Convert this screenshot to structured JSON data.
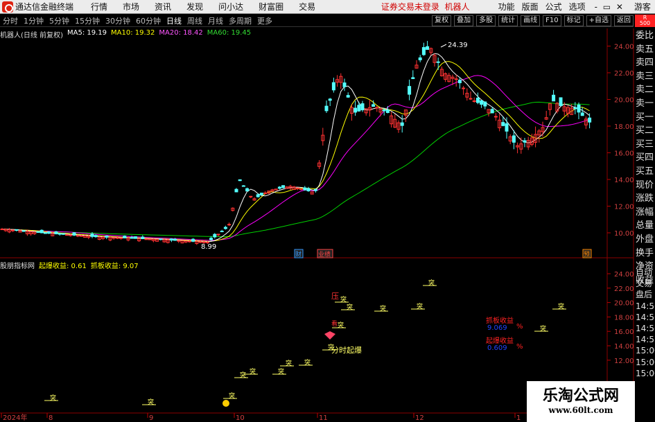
{
  "menubar": {
    "app_title": "通达信金融终端",
    "menu": [
      "行情",
      "市场",
      "资讯",
      "发现",
      "问小达",
      "财富圈",
      "交易"
    ],
    "warning": "证券交易未登录",
    "stock_name": "机器人",
    "right_menu": [
      "功能",
      "版面",
      "公式",
      "选项"
    ],
    "window_controls": "- ▭ ✕",
    "guest": "游客"
  },
  "periodbar": {
    "periods": [
      "分时",
      "1分钟",
      "5分钟",
      "15分钟",
      "30分钟",
      "60分钟",
      "日线",
      "周线",
      "月线",
      "多周期",
      "更多"
    ],
    "active": "日线",
    "tools": [
      "复权",
      "叠加",
      "多股",
      "统计",
      "画线",
      "F10",
      "标记",
      "+自选",
      "返回"
    ],
    "badge_r": "R",
    "badge_num": "500"
  },
  "info": {
    "title": "机器人(日线 前复权)",
    "ma5": "MA5: 19.19",
    "ma10": "MA10: 19.32",
    "ma20": "MA20: 18.42",
    "ma60": "MA60: 19.45"
  },
  "indicator": {
    "name": "股朋指标网",
    "qibao": "起爆收益: 0.61",
    "zhuaban": "抓板收益: 9.07"
  },
  "price_axis": [
    "24.00",
    "22.00",
    "20.00",
    "18.00",
    "16.00",
    "14.00",
    "12.00",
    "10.00"
  ],
  "ind_axis": [
    "24.00",
    "22.00",
    "20.00",
    "18.00",
    "16.00",
    "14.00",
    "12.00"
  ],
  "annotations": {
    "high": "24.39",
    "low": "8.99",
    "cai": "财",
    "ying": "业绩",
    "yu": "预",
    "ya": "压",
    "tu": "突",
    "fenshi": "分时起爆",
    "wbox1_label": "抓板收益",
    "wbox1_val": "9.069",
    "wbox2_label": "起爆收益",
    "wbox2_val": "0.609",
    "pct": "%",
    "kan": "看"
  },
  "date_axis": [
    "2024年",
    "8",
    "9",
    "10",
    "11",
    "12",
    "1"
  ],
  "right_panel_top": [
    "委比",
    "卖五",
    "卖四",
    "卖三",
    "卖二",
    "卖一",
    "买一",
    "买二",
    "买三",
    "买四",
    "买五",
    "现价",
    "涨跌",
    "涨幅",
    "总量",
    "外盘",
    "换手",
    "净资",
    "收益"
  ],
  "right_panel_bottom": [
    "自动",
    "交易",
    "盘后",
    "14:56",
    "14:56",
    "14:56",
    "14:57",
    "15:00",
    "15:00",
    "15:00"
  ],
  "watermark": {
    "title": "乐淘公式网",
    "url": "www.60lt.com"
  },
  "colors": {
    "up": "#ff3232",
    "down": "#54ffff",
    "ma5": "#ffffff",
    "ma10": "#ffff00",
    "ma20": "#ff00ff",
    "ma60": "#00d000"
  }
}
